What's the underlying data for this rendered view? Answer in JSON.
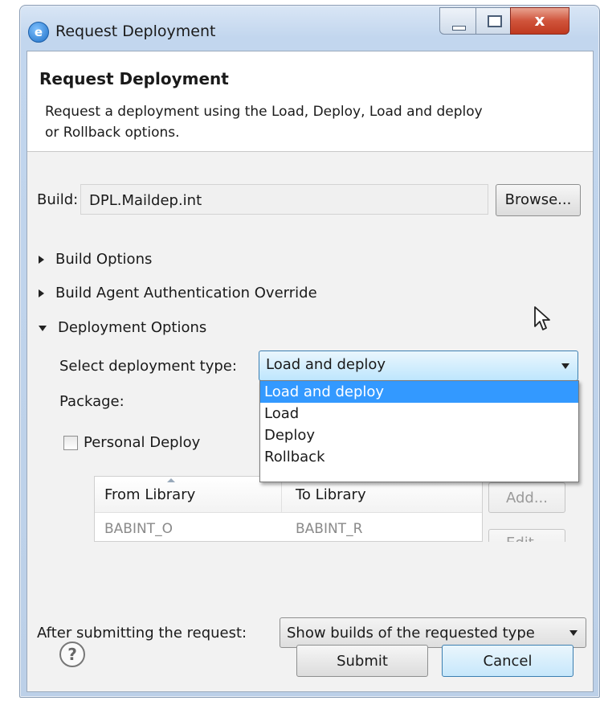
{
  "window": {
    "title": "Request Deployment",
    "close_glyph": "x"
  },
  "banner": {
    "title": "Request Deployment",
    "description": "Request a deployment using the Load, Deploy, Load and deploy or Rollback options."
  },
  "build": {
    "label": "Build:",
    "value": "DPL.Maildep.int",
    "browse_label": "Browse..."
  },
  "sections": {
    "build_options": "Build Options",
    "agent_auth": "Build Agent Authentication Override",
    "deployment_options": "Deployment Options"
  },
  "deployment": {
    "type_label": "Select deployment type:",
    "type_value": "Load and deploy",
    "options": [
      "Load and deploy",
      "Load",
      "Deploy",
      "Rollback"
    ],
    "package_label": "Package:",
    "personal_deploy_label": "Personal Deploy",
    "personal_deploy_checked": false
  },
  "library_table": {
    "columns": [
      "From Library",
      "To Library"
    ],
    "rows": [
      [
        "BABINT_O",
        "BABINT_R"
      ]
    ],
    "add_label": "Add...",
    "edit_label": "Edit..."
  },
  "after_submit": {
    "label": "After submitting the request:",
    "value": "Show builds of the requested type"
  },
  "footer": {
    "help_glyph": "?",
    "submit_label": "Submit",
    "cancel_label": "Cancel"
  },
  "colors": {
    "selection": "#3399ff",
    "title_bar": "#c2d6ee",
    "close_button": "#c0391f"
  }
}
